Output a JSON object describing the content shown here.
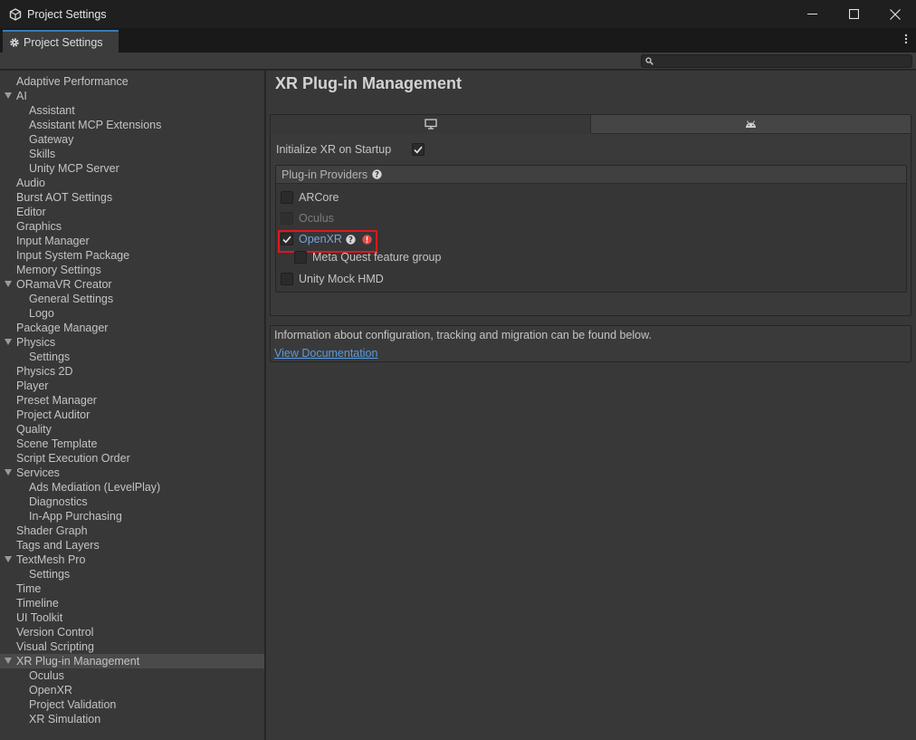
{
  "window": {
    "title": "Project Settings"
  },
  "tab": {
    "label": "Project Settings"
  },
  "search": {
    "placeholder": ""
  },
  "sidebar": {
    "items": [
      {
        "label": "Adaptive Performance",
        "level": 0
      },
      {
        "label": "AI",
        "level": 0,
        "expanded": true
      },
      {
        "label": "Assistant",
        "level": 1
      },
      {
        "label": "Assistant MCP Extensions",
        "level": 1
      },
      {
        "label": "Gateway",
        "level": 1
      },
      {
        "label": "Skills",
        "level": 1
      },
      {
        "label": "Unity MCP Server",
        "level": 1
      },
      {
        "label": "Audio",
        "level": 0
      },
      {
        "label": "Burst AOT Settings",
        "level": 0
      },
      {
        "label": "Editor",
        "level": 0
      },
      {
        "label": "Graphics",
        "level": 0
      },
      {
        "label": "Input Manager",
        "level": 0
      },
      {
        "label": "Input System Package",
        "level": 0
      },
      {
        "label": "Memory Settings",
        "level": 0
      },
      {
        "label": "ORamaVR Creator",
        "level": 0,
        "expanded": true
      },
      {
        "label": "General Settings",
        "level": 1
      },
      {
        "label": "Logo",
        "level": 1
      },
      {
        "label": "Package Manager",
        "level": 0
      },
      {
        "label": "Physics",
        "level": 0,
        "expanded": true
      },
      {
        "label": "Settings",
        "level": 1
      },
      {
        "label": "Physics 2D",
        "level": 0
      },
      {
        "label": "Player",
        "level": 0
      },
      {
        "label": "Preset Manager",
        "level": 0
      },
      {
        "label": "Project Auditor",
        "level": 0
      },
      {
        "label": "Quality",
        "level": 0
      },
      {
        "label": "Scene Template",
        "level": 0
      },
      {
        "label": "Script Execution Order",
        "level": 0
      },
      {
        "label": "Services",
        "level": 0,
        "expanded": true
      },
      {
        "label": "Ads Mediation (LevelPlay)",
        "level": 1
      },
      {
        "label": "Diagnostics",
        "level": 1
      },
      {
        "label": "In-App Purchasing",
        "level": 1
      },
      {
        "label": "Shader Graph",
        "level": 0
      },
      {
        "label": "Tags and Layers",
        "level": 0
      },
      {
        "label": "TextMesh Pro",
        "level": 0,
        "expanded": true
      },
      {
        "label": "Settings",
        "level": 1
      },
      {
        "label": "Time",
        "level": 0
      },
      {
        "label": "Timeline",
        "level": 0
      },
      {
        "label": "UI Toolkit",
        "level": 0
      },
      {
        "label": "Version Control",
        "level": 0
      },
      {
        "label": "Visual Scripting",
        "level": 0
      },
      {
        "label": "XR Plug-in Management",
        "level": 0,
        "expanded": true,
        "selected": true
      },
      {
        "label": "Oculus",
        "level": 1
      },
      {
        "label": "OpenXR",
        "level": 1
      },
      {
        "label": "Project Validation",
        "level": 1
      },
      {
        "label": "XR Simulation",
        "level": 1
      }
    ]
  },
  "main": {
    "title": "XR Plug-in Management",
    "platform_tabs": [
      {
        "icon": "monitor-icon",
        "active": true
      },
      {
        "icon": "android-icon",
        "active": false
      }
    ],
    "init_label": "Initialize XR on Startup",
    "init_checked": true,
    "providers_header": "Plug-in Providers",
    "providers": [
      {
        "label": "ARCore",
        "checked": false,
        "disabled": false
      },
      {
        "label": "Oculus",
        "checked": false,
        "disabled": true
      },
      {
        "label": "OpenXR",
        "checked": true,
        "disabled": false
      },
      {
        "label": "Meta Quest feature group",
        "checked": false,
        "disabled": false
      },
      {
        "label": "Unity Mock HMD",
        "checked": false,
        "disabled": false
      }
    ],
    "info_text": "Information about configuration, tracking and migration can be found below.",
    "info_link": "View Documentation"
  },
  "colors": {
    "accent": "#3a79bb",
    "link": "#5a9bdf",
    "highlight": "#e0161d",
    "error": "#e8494c"
  }
}
